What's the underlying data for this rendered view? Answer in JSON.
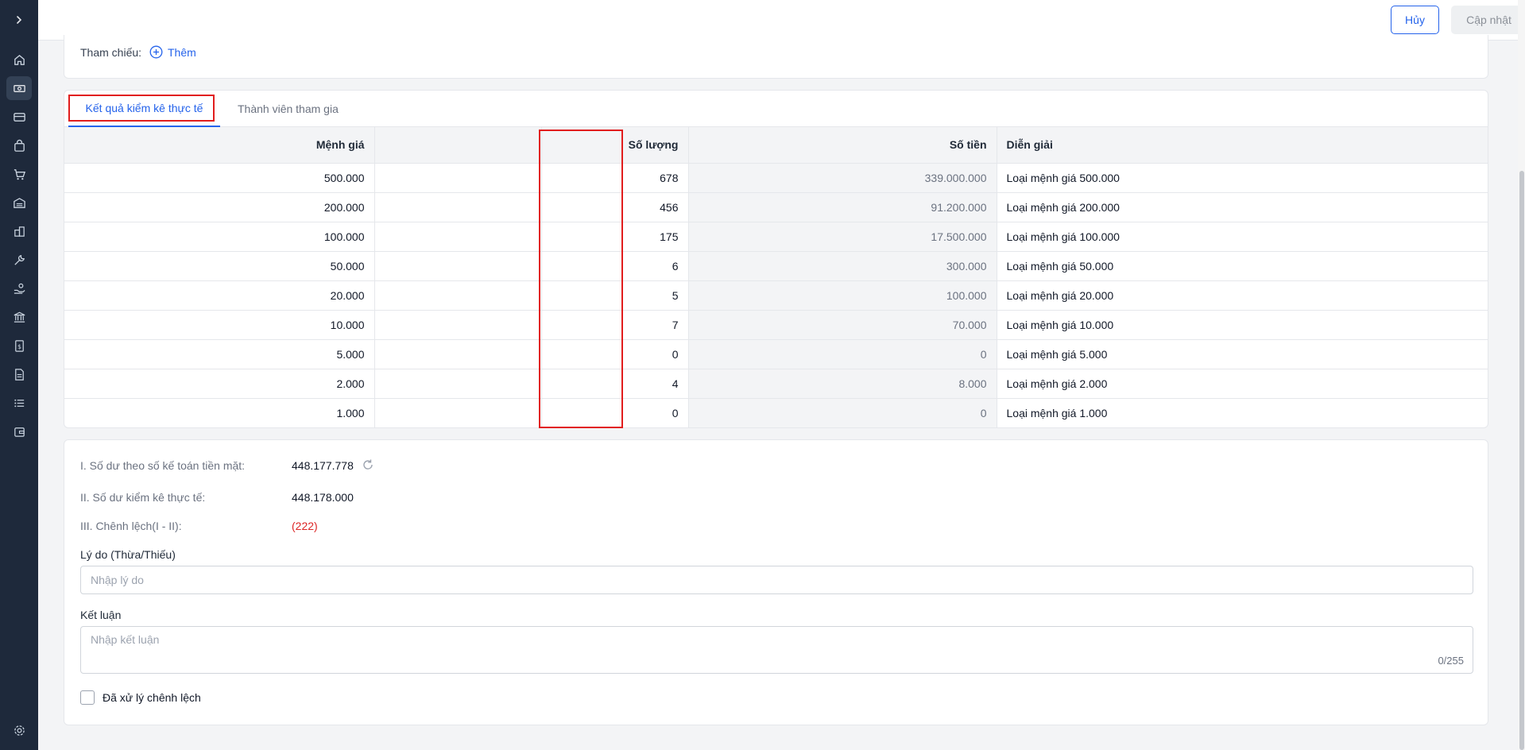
{
  "header": {
    "cancel_label": "Hủy",
    "update_label": "Cập nhật"
  },
  "reference": {
    "label": "Tham chiếu:",
    "add_label": "Thêm"
  },
  "tabs": [
    {
      "label": "Kết quả kiểm kê thực tế",
      "active": true
    },
    {
      "label": "Thành viên tham gia",
      "active": false
    }
  ],
  "table": {
    "columns": [
      "Mệnh giá",
      "",
      "Số lượng",
      "Số tiền",
      "Diễn giải"
    ],
    "rows": [
      {
        "denomination": "500.000",
        "quantity": "678",
        "amount": "339.000.000",
        "description": "Loại mệnh giá 500.000"
      },
      {
        "denomination": "200.000",
        "quantity": "456",
        "amount": "91.200.000",
        "description": "Loại mệnh giá 200.000"
      },
      {
        "denomination": "100.000",
        "quantity": "175",
        "amount": "17.500.000",
        "description": "Loại mệnh giá 100.000"
      },
      {
        "denomination": "50.000",
        "quantity": "6",
        "amount": "300.000",
        "description": "Loại mệnh giá 50.000"
      },
      {
        "denomination": "20.000",
        "quantity": "5",
        "amount": "100.000",
        "description": "Loại mệnh giá 20.000"
      },
      {
        "denomination": "10.000",
        "quantity": "7",
        "amount": "70.000",
        "description": "Loại mệnh giá 10.000"
      },
      {
        "denomination": "5.000",
        "quantity": "0",
        "amount": "0",
        "description": "Loại mệnh giá 5.000"
      },
      {
        "denomination": "2.000",
        "quantity": "4",
        "amount": "8.000",
        "description": "Loại mệnh giá 2.000"
      },
      {
        "denomination": "1.000",
        "quantity": "0",
        "amount": "0",
        "description": "Loại mệnh giá 1.000"
      }
    ]
  },
  "summary": {
    "book_balance_label": "I. Số dư theo số kế toán tiền mặt:",
    "book_balance_value": "448.177.778",
    "actual_balance_label": "II. Số dư kiểm kê thực tế:",
    "actual_balance_value": "448.178.000",
    "difference_label": "III. Chênh lệch(I - II):",
    "difference_value": "(222)",
    "reason_label": "Lý do (Thừa/Thiếu)",
    "reason_placeholder": "Nhập lý do",
    "conclusion_label": "Kết luận",
    "conclusion_placeholder": "Nhập kết luận",
    "conclusion_counter": "0/255",
    "processed_label": "Đã xử lý chênh lệch"
  },
  "sidebar": {
    "icons": [
      "chevron-right-icon",
      "home-icon",
      "cash-icon",
      "card-icon",
      "bag-icon",
      "cart-icon",
      "warehouse-icon",
      "building-icon",
      "tools-icon",
      "hand-coin-icon",
      "bank-icon",
      "receipt-icon",
      "document-icon",
      "list-icon",
      "wallet-icon",
      "settings-icon"
    ]
  },
  "colors": {
    "accent": "#2563eb",
    "sidebar": "#1e293b",
    "highlight": "#e11d1d",
    "negative": "#dc2626"
  }
}
